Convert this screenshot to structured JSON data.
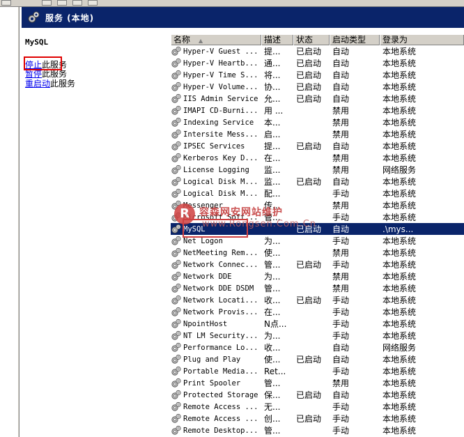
{
  "window": {
    "title": "服务 (本地)",
    "title_icon": "services-gear-icon"
  },
  "left_pane": {
    "service_name": "MySQL",
    "actions": [
      {
        "link": "停止",
        "rest": "此服务"
      },
      {
        "link": "暂停",
        "rest": "此服务"
      },
      {
        "link": "重启动",
        "rest": "此服务"
      }
    ]
  },
  "table": {
    "columns": [
      "名称",
      "描述",
      "状态",
      "启动类型",
      "登录为"
    ],
    "sort_indicator": "▲",
    "rows": [
      {
        "name": "Hyper-V Guest ...",
        "desc": "提...",
        "status": "已启动",
        "startup": "自动",
        "logon": "本地系统"
      },
      {
        "name": "Hyper-V Heartb...",
        "desc": "通...",
        "status": "已启动",
        "startup": "自动",
        "logon": "本地系统"
      },
      {
        "name": "Hyper-V Time S...",
        "desc": "将...",
        "status": "已启动",
        "startup": "自动",
        "logon": "本地系统"
      },
      {
        "name": "Hyper-V Volume...",
        "desc": "协...",
        "status": "已启动",
        "startup": "自动",
        "logon": "本地系统"
      },
      {
        "name": "IIS Admin Service",
        "desc": "允...",
        "status": "已启动",
        "startup": "自动",
        "logon": "本地系统"
      },
      {
        "name": "IMAPI CD-Burni...",
        "desc": "用 ...",
        "status": "",
        "startup": "禁用",
        "logon": "本地系统"
      },
      {
        "name": "Indexing Service",
        "desc": "本...",
        "status": "",
        "startup": "禁用",
        "logon": "本地系统"
      },
      {
        "name": "Intersite Mess...",
        "desc": "启...",
        "status": "",
        "startup": "禁用",
        "logon": "本地系统"
      },
      {
        "name": "IPSEC Services",
        "desc": "提...",
        "status": "已启动",
        "startup": "自动",
        "logon": "本地系统"
      },
      {
        "name": "Kerberos Key D...",
        "desc": "在...",
        "status": "",
        "startup": "禁用",
        "logon": "本地系统"
      },
      {
        "name": "License Logging",
        "desc": "监...",
        "status": "",
        "startup": "禁用",
        "logon": "网络服务"
      },
      {
        "name": "Logical Disk M...",
        "desc": "监...",
        "status": "已启动",
        "startup": "自动",
        "logon": "本地系统"
      },
      {
        "name": "Logical Disk M...",
        "desc": "配...",
        "status": "",
        "startup": "手动",
        "logon": "本地系统"
      },
      {
        "name": "Messenger",
        "desc": "传...",
        "status": "",
        "startup": "禁用",
        "logon": "本地系统"
      },
      {
        "name": "Microsoft Soft...",
        "desc": "管...",
        "status": "",
        "startup": "手动",
        "logon": "本地系统"
      },
      {
        "name": "MySQL",
        "desc": "",
        "status": "已启动",
        "startup": "自动",
        "logon": ".\\mys...",
        "selected": true
      },
      {
        "name": "Net Logon",
        "desc": "为...",
        "status": "",
        "startup": "手动",
        "logon": "本地系统"
      },
      {
        "name": "NetMeeting Rem...",
        "desc": "使...",
        "status": "",
        "startup": "禁用",
        "logon": "本地系统"
      },
      {
        "name": "Network Connec...",
        "desc": "管...",
        "status": "已启动",
        "startup": "手动",
        "logon": "本地系统"
      },
      {
        "name": "Network DDE",
        "desc": "为...",
        "status": "",
        "startup": "禁用",
        "logon": "本地系统"
      },
      {
        "name": "Network DDE DSDM",
        "desc": "管...",
        "status": "",
        "startup": "禁用",
        "logon": "本地系统"
      },
      {
        "name": "Network Locati...",
        "desc": "收...",
        "status": "已启动",
        "startup": "手动",
        "logon": "本地系统"
      },
      {
        "name": "Network Provis...",
        "desc": "在...",
        "status": "",
        "startup": "手动",
        "logon": "本地系统"
      },
      {
        "name": "NpointHost",
        "desc": "N点...",
        "status": "",
        "startup": "手动",
        "logon": "本地系统"
      },
      {
        "name": "NT LM Security...",
        "desc": "为...",
        "status": "",
        "startup": "手动",
        "logon": "本地系统"
      },
      {
        "name": "Performance Lo...",
        "desc": "收...",
        "status": "",
        "startup": "自动",
        "logon": "网络服务"
      },
      {
        "name": "Plug and Play",
        "desc": "使...",
        "status": "已启动",
        "startup": "自动",
        "logon": "本地系统"
      },
      {
        "name": "Portable Media...",
        "desc": "Ret...",
        "status": "",
        "startup": "手动",
        "logon": "本地系统"
      },
      {
        "name": "Print Spooler",
        "desc": "管...",
        "status": "",
        "startup": "禁用",
        "logon": "本地系统"
      },
      {
        "name": "Protected Storage",
        "desc": "保...",
        "status": "已启动",
        "startup": "自动",
        "logon": "本地系统"
      },
      {
        "name": "Remote Access ...",
        "desc": "无...",
        "status": "",
        "startup": "手动",
        "logon": "本地系统"
      },
      {
        "name": "Remote Access ...",
        "desc": "创...",
        "status": "已启动",
        "startup": "手动",
        "logon": "本地系统"
      },
      {
        "name": "Remote Desktop...",
        "desc": "管...",
        "status": "",
        "startup": "手动",
        "logon": "本地系统"
      }
    ]
  },
  "watermark": {
    "logo_letter": "R",
    "cn": "容森网安网站维护",
    "en": "www.Rongsen.Com.Cn"
  },
  "colors": {
    "title_bar": "#0a246a",
    "selection": "#0a246a",
    "highlight_box": "#e00000",
    "link": "#0000ee"
  }
}
